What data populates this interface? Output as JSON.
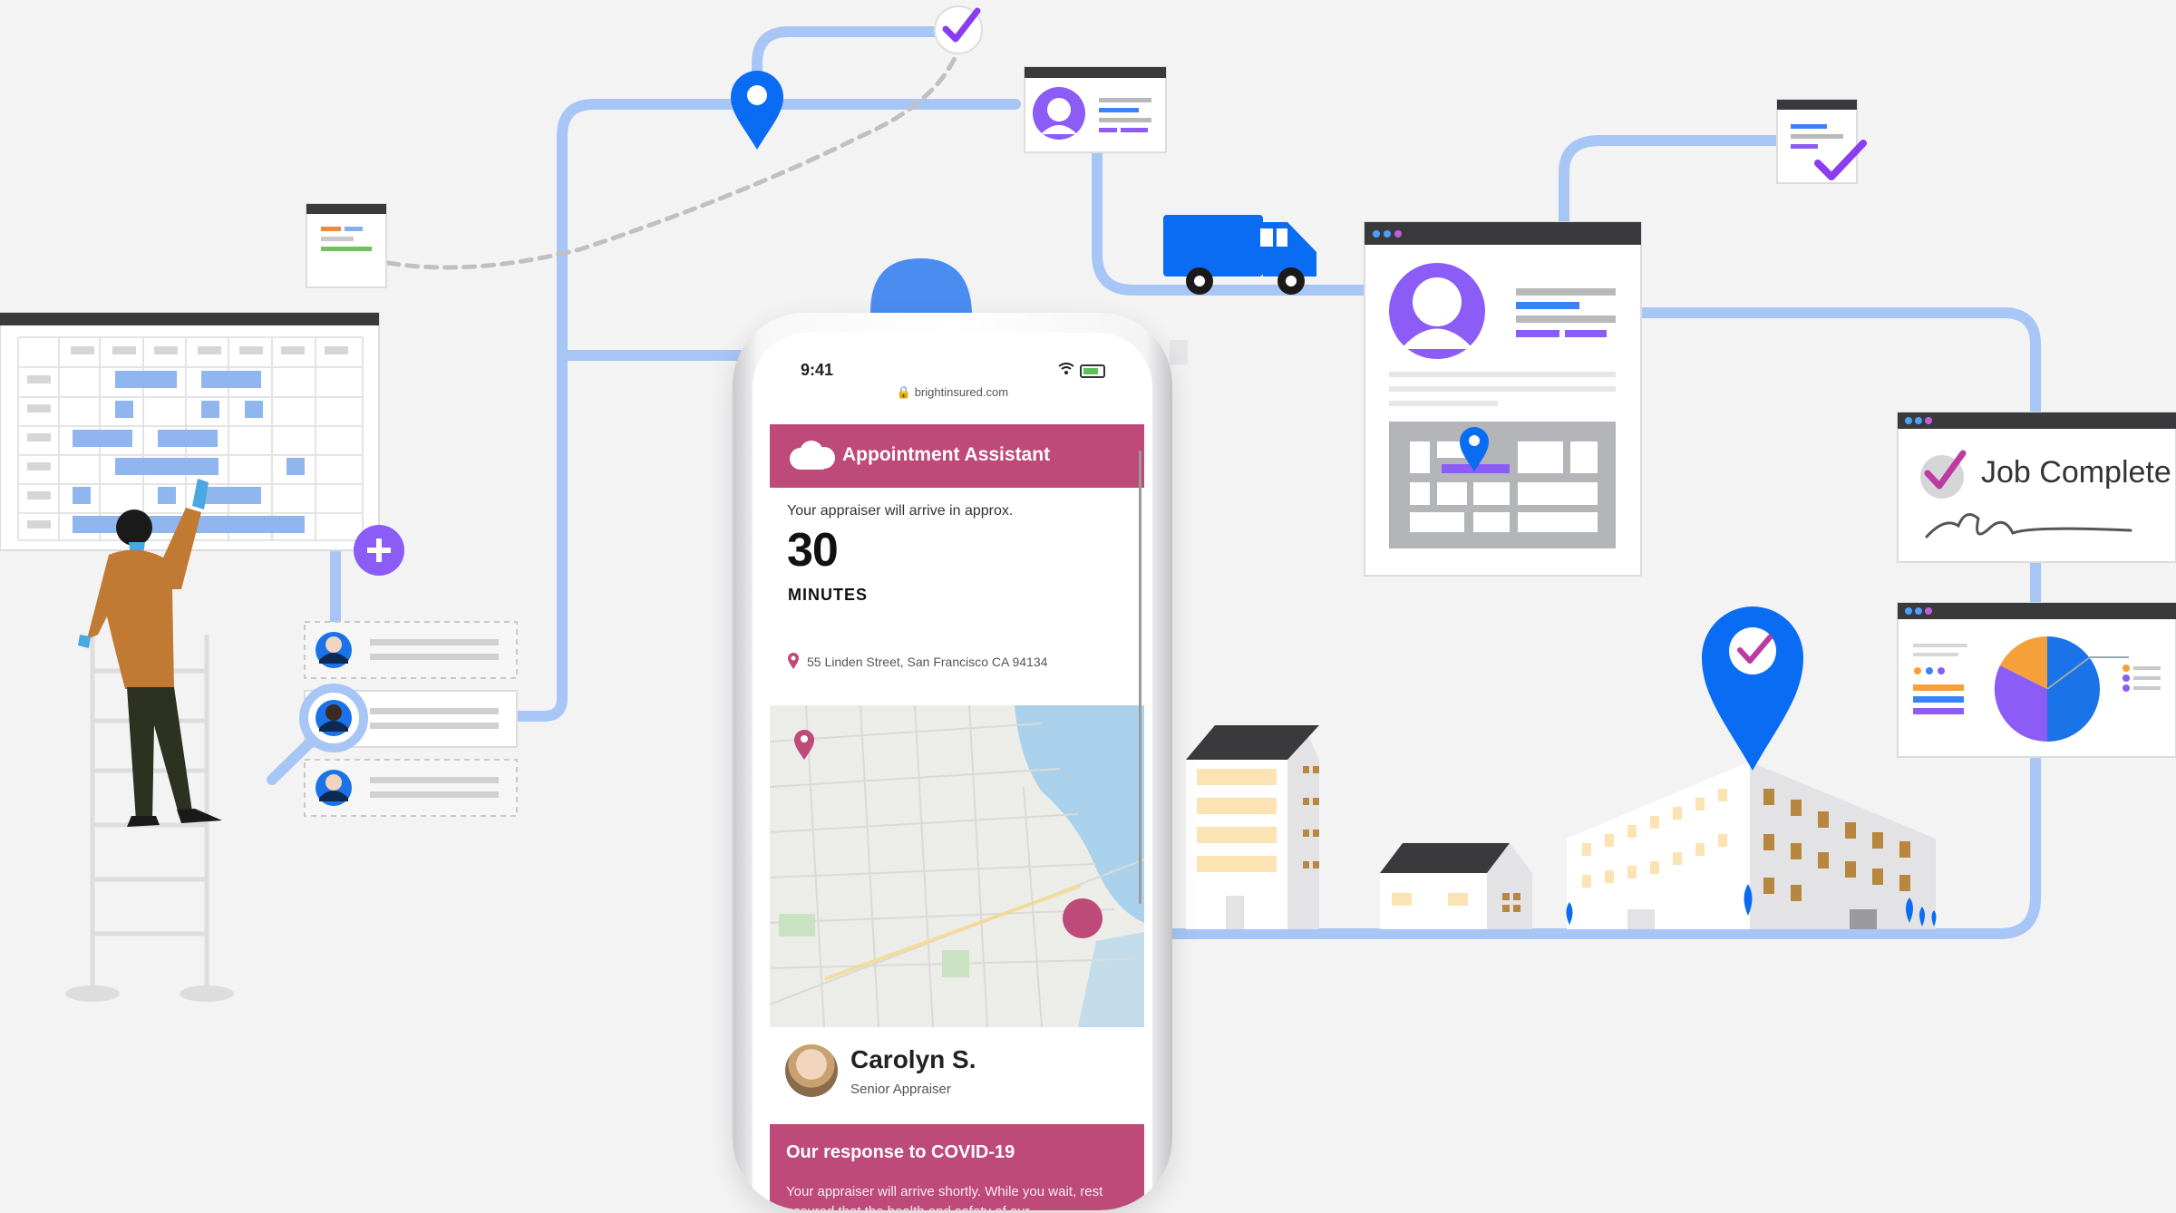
{
  "colors": {
    "route_blue": "#a7c6f5",
    "brand_blue": "#1a73e8",
    "pin_blue": "#0a6cf2",
    "magenta": "#bd4a78",
    "purple": "#8b5cf6",
    "check_purple": "#9333ea",
    "orange_pie": "#f5a03a"
  },
  "icons": {
    "location_pin": "map-pin-icon",
    "check": "checkmark-icon",
    "truck": "delivery-truck-icon",
    "add": "plus-icon",
    "search": "magnifier-icon",
    "wifi": "wifi-icon",
    "lock": "lock-icon",
    "cloud": "salesforce-cloud-icon"
  },
  "phone": {
    "status_time": "9:41",
    "url": "🔒 brightinsured.com",
    "app_title": "Appointment Assistant",
    "arrival_text": "Your appraiser will arrive in approx.",
    "minutes_value": "30",
    "minutes_label": "MINUTES",
    "address": "55 Linden Street, San Francisco CA 94134",
    "appraiser_name": "Carolyn S.",
    "appraiser_role": "Senior Appraiser",
    "covid_title": "Our response to COVID-19",
    "covid_text": "Your appraiser will arrive shortly. While you wait, rest assured that the health and safety of our"
  },
  "job_card": {
    "label": "Job Complete"
  }
}
